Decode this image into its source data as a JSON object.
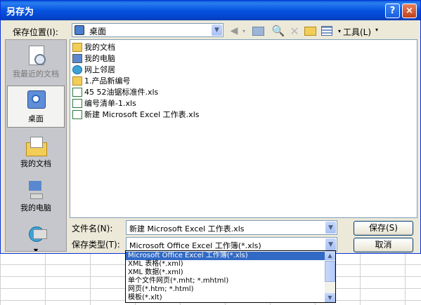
{
  "window": {
    "title": "另存为",
    "help_label": "?",
    "close_label": "×"
  },
  "toolbar": {
    "save_in_label": "保存位置(I):",
    "save_in_value": "桌面",
    "tools_label": "工具(L)"
  },
  "places": [
    {
      "label": "我最近的文档",
      "icon": "recent-docs-icon"
    },
    {
      "label": "桌面",
      "icon": "desktop-icon"
    },
    {
      "label": "我的文档",
      "icon": "my-documents-icon"
    },
    {
      "label": "我的电脑",
      "icon": "my-computer-icon"
    },
    {
      "label": "",
      "icon": "network-places-icon"
    }
  ],
  "files": [
    {
      "name": "我的文档",
      "icon": "folder-doc-icon"
    },
    {
      "name": "我的电脑",
      "icon": "computer-icon"
    },
    {
      "name": "网上邻居",
      "icon": "network-icon"
    },
    {
      "name": "1.产品新编号",
      "icon": "folder-icon"
    },
    {
      "name": "45 52油锯标准件.xls",
      "icon": "excel-file-icon"
    },
    {
      "name": "编号清单-1.xls",
      "icon": "excel-file-icon"
    },
    {
      "name": "新建 Microsoft Excel 工作表.xls",
      "icon": "excel-file-icon"
    }
  ],
  "form": {
    "filename_label": "文件名(N):",
    "filename_value": "新建 Microsoft Excel 工作表.xls",
    "filetype_label": "保存类型(T):",
    "filetype_value": "Microsoft Office Excel 工作簿(*.xls)"
  },
  "buttons": {
    "save": "保存(S)",
    "cancel": "取消"
  },
  "filetype_options": [
    "Microsoft Office Excel 工作簿(*.xls)",
    "XML 表格(*.xml)",
    "XML 数据(*.xml)",
    "单个文件网页(*.mht; *.mhtml)",
    "网页(*.htm; *.html)",
    "模板(*.xlt)"
  ],
  "colors": {
    "title_bar": "#0553e0",
    "dialog_bg": "#ece9d8",
    "selection": "#316ac5"
  }
}
